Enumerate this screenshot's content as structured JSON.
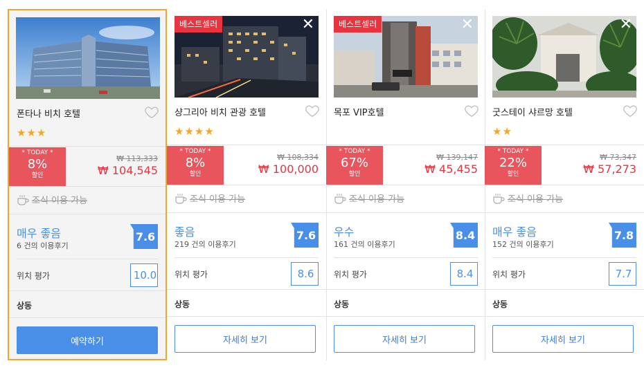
{
  "hotels": [
    {
      "name": "폰타나 비치 호텔",
      "badge": "",
      "stars": "★★★",
      "deal_tag": "* TODAY *",
      "discount": "8%",
      "discount_label": "할인",
      "original_price": "₩ 113,333",
      "price": "₩ 104,545",
      "breakfast": "조식 이용 가능",
      "rating_text": "매우 좋음",
      "review_count": "6 건의 이용후기",
      "rating": "7.6",
      "location_label": "위치 평가",
      "location_score": "10.0",
      "area": "상동",
      "button": "예약하기"
    },
    {
      "name": "샹그리아 비치 관광 호텔",
      "badge": "베스트셀러",
      "stars": "★★★★",
      "deal_tag": "* TODAY *",
      "discount": "8%",
      "discount_label": "할인",
      "original_price": "₩ 108,334",
      "price": "₩ 100,000",
      "breakfast": "조식 이용 가능",
      "rating_text": "좋음",
      "review_count": "219 건의 이용후기",
      "rating": "7.6",
      "location_label": "위치 평가",
      "location_score": "8.6",
      "area": "상동",
      "button": "자세히 보기"
    },
    {
      "name": "목포 VIP호텔",
      "badge": "베스트셀러",
      "stars": "",
      "deal_tag": "* TODAY *",
      "discount": "67%",
      "discount_label": "할인",
      "original_price": "₩ 139,147",
      "price": "₩ 45,455",
      "breakfast": "조식 이용 가능",
      "rating_text": "우수",
      "review_count": "161 건의 이용후기",
      "rating": "8.4",
      "location_label": "위치 평가",
      "location_score": "8.4",
      "area": "상동",
      "button": "자세히 보기"
    },
    {
      "name": "굿스테이 샤르망 호텔",
      "badge": "",
      "stars": "★★",
      "deal_tag": "* TODAY *",
      "discount": "22%",
      "discount_label": "할인",
      "original_price": "₩ 73,347",
      "price": "₩ 57,273",
      "breakfast": "조식 이용 가능",
      "rating_text": "매우 좋음",
      "review_count": "152 건의 이용후기",
      "rating": "7.8",
      "location_label": "위치 평가",
      "location_score": "7.7",
      "area": "상동",
      "button": "자세히 보기"
    }
  ],
  "icons": {
    "close": "close-icon",
    "favorite": "heart-icon",
    "breakfast": "coffee-cup-icon"
  },
  "colors": {
    "accent": "#4a8fe7",
    "deal": "#e9555c",
    "price": "#e8343e",
    "stars": "#f5a623",
    "selected_border": "#f5a623"
  }
}
